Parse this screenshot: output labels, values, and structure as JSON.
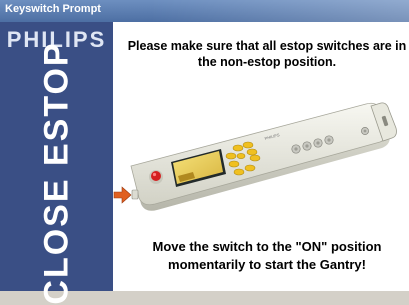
{
  "window": {
    "title": "Keyswitch Prompt"
  },
  "sidebar": {
    "brand": "PHILIPS",
    "vertical_text": "CLOSE ESTOP"
  },
  "main": {
    "instruction_top": "Please make sure that all estop switches are in the non-estop position.",
    "instruction_bottom": "Move the switch to the \"ON\" position momentarily to start the Gantry!",
    "device_brand": "PHILIPS"
  },
  "colors": {
    "titlebar": "#5b7db3",
    "sidebar": "#3a4f85",
    "arrow": "#e06020",
    "estop": "#d42020",
    "buttons": "#f0c020"
  }
}
